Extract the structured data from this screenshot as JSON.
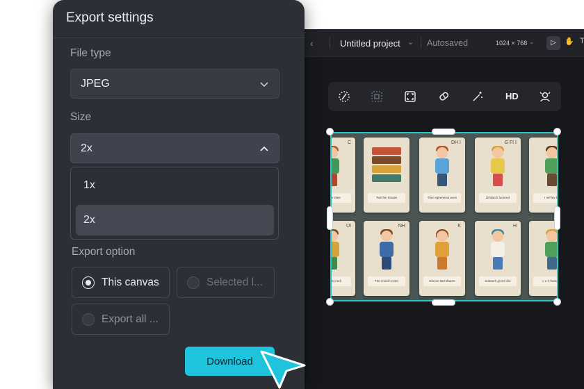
{
  "editor": {
    "project_name": "Untitled project",
    "save_status": "Autosaved",
    "canvas_size": "1024 × 768",
    "toolbar": {
      "hd_label": "HD",
      "icons": [
        "brush-remove-icon",
        "crop-frame-icon",
        "expand-icon",
        "eraser-icon",
        "magic-wand-icon",
        "hd-icon",
        "face-retouch-icon"
      ]
    },
    "canvas_cards": [
      {
        "corner": "C",
        "caption": "elesse inlee"
      },
      {
        "corner": "",
        "caption": "Twir fen Ibnatis"
      },
      {
        "corner": "DH I",
        "caption": "Ther eghenenst aven"
      },
      {
        "corner": "G  FI I",
        "caption": "Dihilotch fortered"
      },
      {
        "corner": "",
        "caption": "I sef ley bn"
      },
      {
        "corner": "UI",
        "caption": "lt enrds inedi"
      },
      {
        "corner": "NH",
        "caption": "The nnserh enter"
      },
      {
        "corner": "K",
        "caption": "Dirceer Bel bharirs"
      },
      {
        "corner": "H",
        "caption": "Sobserh grorel dre"
      },
      {
        "corner": "",
        "caption": "L e lr frarscna"
      }
    ]
  },
  "export_panel": {
    "title": "Export settings",
    "file_type": {
      "label": "File type",
      "value": "JPEG"
    },
    "size": {
      "label": "Size",
      "value": "2x",
      "options": [
        "1x",
        "2x"
      ],
      "selected": "2x"
    },
    "export_option": {
      "label": "Export option",
      "choices": [
        {
          "label": "This canvas",
          "selected": true,
          "enabled": true
        },
        {
          "label": "Selected l...",
          "selected": false,
          "enabled": false
        },
        {
          "label": "Export all ...",
          "selected": false,
          "enabled": true
        }
      ]
    },
    "download_label": "Download"
  },
  "colors": {
    "accent": "#1fc4dc",
    "selection": "#2ec4c2",
    "panel_bg": "#2d2f37",
    "editor_bg": "#17181c"
  }
}
